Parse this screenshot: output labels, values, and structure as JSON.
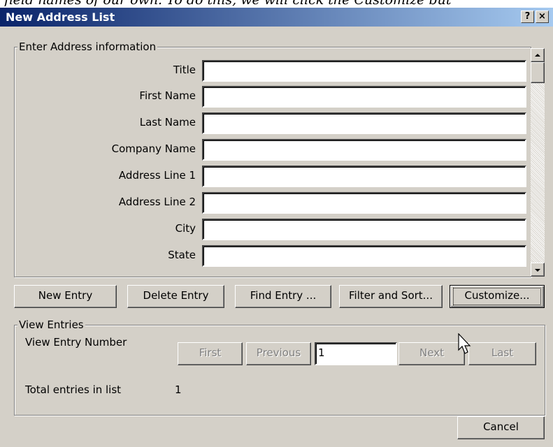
{
  "background_text": "field names of our own. To do this, we will click the Customize but",
  "window": {
    "title": "New Address List",
    "help_label": "?",
    "close_label": "×"
  },
  "address_group": {
    "legend": "Enter Address information",
    "fields": [
      {
        "label": "Title",
        "value": ""
      },
      {
        "label": "First Name",
        "value": ""
      },
      {
        "label": "Last Name",
        "value": ""
      },
      {
        "label": "Company Name",
        "value": ""
      },
      {
        "label": "Address Line 1",
        "value": ""
      },
      {
        "label": "Address Line 2",
        "value": ""
      },
      {
        "label": "City",
        "value": ""
      },
      {
        "label": "State",
        "value": ""
      }
    ]
  },
  "actions": {
    "new_entry": "New Entry",
    "delete_entry": "Delete Entry",
    "find_entry": "Find Entry ...",
    "filter_sort": "Filter and Sort...",
    "customize": "Customize..."
  },
  "view_group": {
    "legend": "View Entries",
    "entry_number_label": "View Entry Number",
    "first": "First",
    "previous": "Previous",
    "entry_number_value": "1",
    "next": "Next",
    "last": "Last",
    "total_label": "Total entries in list",
    "total_value": "1"
  },
  "footer": {
    "cancel": "Cancel"
  }
}
